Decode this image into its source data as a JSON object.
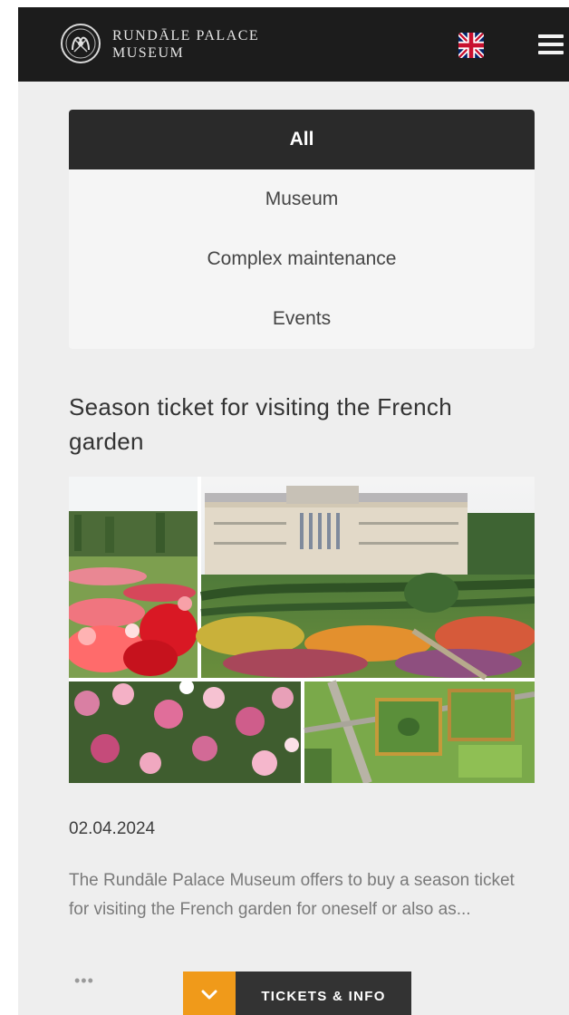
{
  "header": {
    "brand_line1": "RUNDĀLE PALACE",
    "brand_line2": "MUSEUM",
    "logo_icon": "rundale-emblem-icon",
    "language_icon": "uk-flag-icon",
    "menu_icon": "hamburger-menu-icon",
    "background_color": "#1c1c1c"
  },
  "filters": {
    "items": [
      {
        "label": "All",
        "active": true
      },
      {
        "label": "Museum",
        "active": false
      },
      {
        "label": "Complex maintenance",
        "active": false
      },
      {
        "label": "Events",
        "active": false
      }
    ],
    "active_color": "#2a2a2a"
  },
  "article": {
    "title": "Season ticket for visiting the French garden",
    "date": "02.04.2024",
    "excerpt": "The Rundāle Palace Museum offers to buy a season ticket for visiting the French garden for oneself or also as...",
    "more": "•••"
  },
  "tickets_bar": {
    "label": "TICKETS & INFO",
    "icon": "chevron-down-icon",
    "accent_color": "#f09a1a"
  }
}
